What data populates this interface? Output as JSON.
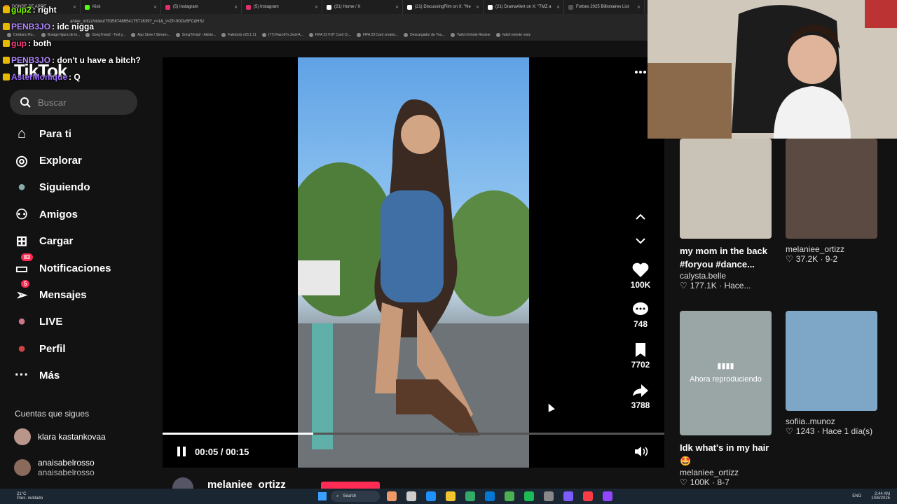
{
  "browser": {
    "tabs": [
      {
        "label": "DONDE SE APRE",
        "color": "#e06c2f"
      },
      {
        "label": "Kick",
        "color": "#53fc18"
      },
      {
        "label": "(5) Instagram",
        "color": "#e1306c"
      },
      {
        "label": "(5) Instagram",
        "color": "#e1306c"
      },
      {
        "label": "(21) Home / X",
        "color": "#ffffff"
      },
      {
        "label": "(21) DiscussingFilm on X: \"Ne",
        "color": "#ffffff"
      },
      {
        "label": "(21) DramaAlert on X: \"TMZ a",
        "color": "#ffffff"
      },
      {
        "label": "Forbes 2025 Billionaires List",
        "color": "#555555"
      }
    ],
    "url": "aniee_ortizz/video/7535874865417571639?_r=1&_t=ZP-90Ov5FCdHSz",
    "bookmarks": [
      "Cristiano Ro...",
      "Burago figura de to...",
      "SongTrivia2 - Test y...",
      "App Store / Stream...",
      "SongTrivia2 - Adivin...",
      "Faletools v25.1.11",
      "(77) Razo97s Zesl-A...",
      "FIFA 23 FUT Card Cr...",
      "FIFA 23 Card creator...",
      "Descargador de You...",
      "Twitch Emote Resizer",
      "twitch emote resiz"
    ]
  },
  "chat": [
    {
      "user": "gup2",
      "msg": ": right",
      "color": "#7fff00"
    },
    {
      "user": "PENB3JO",
      "msg": ": idc nigga",
      "color": "#b388ff"
    },
    {
      "user": "gup",
      "msg": ": both",
      "color": "#ff4081"
    },
    {
      "user": "PENB3JO",
      "msg": ": don't u have a bitch?",
      "color": "#b388ff"
    },
    {
      "user": "AsterMonique",
      "msg": ": Q",
      "color": "#9c6bff"
    }
  ],
  "app": {
    "logo": "TikTok",
    "search_placeholder": "Buscar"
  },
  "nav": [
    {
      "label": "Para ti",
      "icon": "home-icon"
    },
    {
      "label": "Explorar",
      "icon": "compass-icon"
    },
    {
      "label": "Siguiendo",
      "icon": "following-avatar-icon"
    },
    {
      "label": "Amigos",
      "icon": "friends-icon"
    },
    {
      "label": "Cargar",
      "icon": "upload-icon"
    },
    {
      "label": "Notificaciones",
      "icon": "inbox-icon",
      "count": "83"
    },
    {
      "label": "Mensajes",
      "icon": "send-icon",
      "count": "5"
    },
    {
      "label": "LIVE",
      "icon": "live-icon"
    },
    {
      "label": "Perfil",
      "icon": "profile-icon"
    },
    {
      "label": "Más",
      "icon": "more-icon"
    }
  ],
  "following": {
    "title": "Cuentas que sigues",
    "accounts": [
      {
        "name": "klara kastankovaa",
        "handle": ""
      },
      {
        "name": "anaisabelrosso",
        "handle": "anaisabelrosso"
      }
    ]
  },
  "player": {
    "time": "00:05 / 00:15",
    "progress": 0.3,
    "author": "melaniee_ortizz"
  },
  "actions": {
    "likes": "100K",
    "comments": "748",
    "saves": "7702",
    "shares": "3788"
  },
  "recommendations": [
    {
      "title": "my mom in the back #foryou #dance...",
      "author": "calysta.belle",
      "stats": "177.1K · Hace..."
    },
    {
      "title": "",
      "author": "melaniee_ortizz",
      "stats": "37.2K · 9-2"
    },
    {
      "title": "Idk what's in my hair 🤩",
      "author": "melaniee_ortizz",
      "stats": "100K · 8-7",
      "overlay": "Ahora reproduciendo"
    },
    {
      "title": "",
      "author": "sofiia..munoz",
      "stats": "1243 · Hace 1 día(s)"
    }
  ],
  "taskbar": {
    "weather": "21°C",
    "weather_desc": "Parc. nublado",
    "search": "Search",
    "lang": "ENG",
    "time": "2:44 AM",
    "date": "10/8/2025"
  }
}
